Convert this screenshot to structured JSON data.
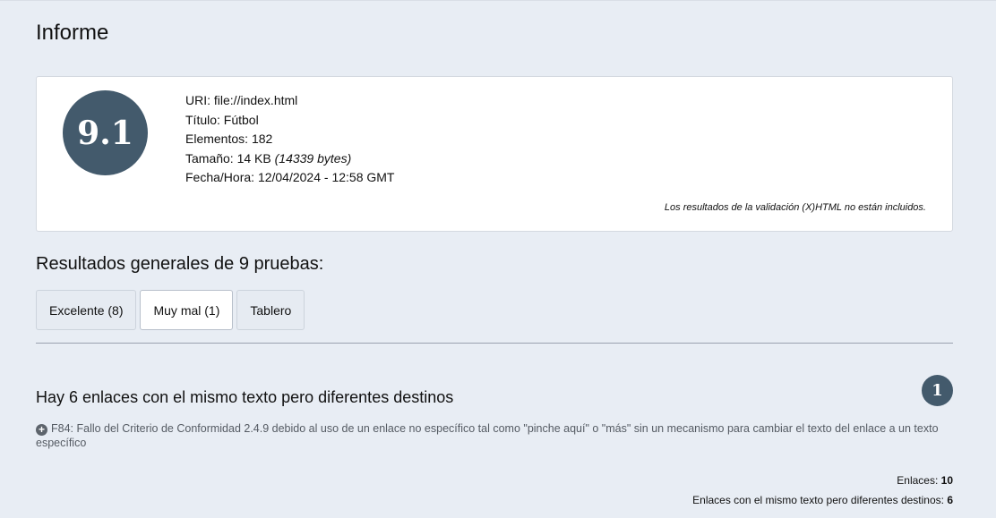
{
  "page": {
    "title": "Informe"
  },
  "summary": {
    "score": "9.1",
    "uri_label": "URI:",
    "uri_value": "file://index.html",
    "title_label": "Título:",
    "title_value": "Fútbol",
    "elements_label": "Elementos:",
    "elements_value": "182",
    "size_label": "Tamaño:",
    "size_value": "14 KB",
    "size_bytes": "(14339 bytes)",
    "datetime_label": "Fecha/Hora:",
    "datetime_value": "12/04/2024 - 12:58 GMT",
    "validation_note": "Los resultados de la validación (X)HTML no están incluidos."
  },
  "results": {
    "heading": "Resultados generales de 9 pruebas:",
    "tabs": [
      {
        "label": "Excelente (8)",
        "active": false
      },
      {
        "label": "Muy mal (1)",
        "active": true
      },
      {
        "label": "Tablero",
        "active": false
      }
    ]
  },
  "issue": {
    "title": "Hay 6 enlaces con el mismo texto pero diferentes destinos",
    "count": "1",
    "technique_icon": "plus-circle-icon",
    "technique": "F84: Fallo del Criterio de Conformidad 2.4.9 debido al uso de un enlace no específico tal como \"pinche aquí\" o \"más\" sin un mecanismo para cambiar el texto del enlace a un texto específico",
    "stats": [
      {
        "label": "Enlaces:",
        "value": "10"
      },
      {
        "label": "Enlaces con el mismo texto pero diferentes destinos:",
        "value": "6"
      }
    ]
  },
  "colors": {
    "background": "#e8edf4",
    "badge": "#435a6c",
    "card": "#ffffff"
  }
}
